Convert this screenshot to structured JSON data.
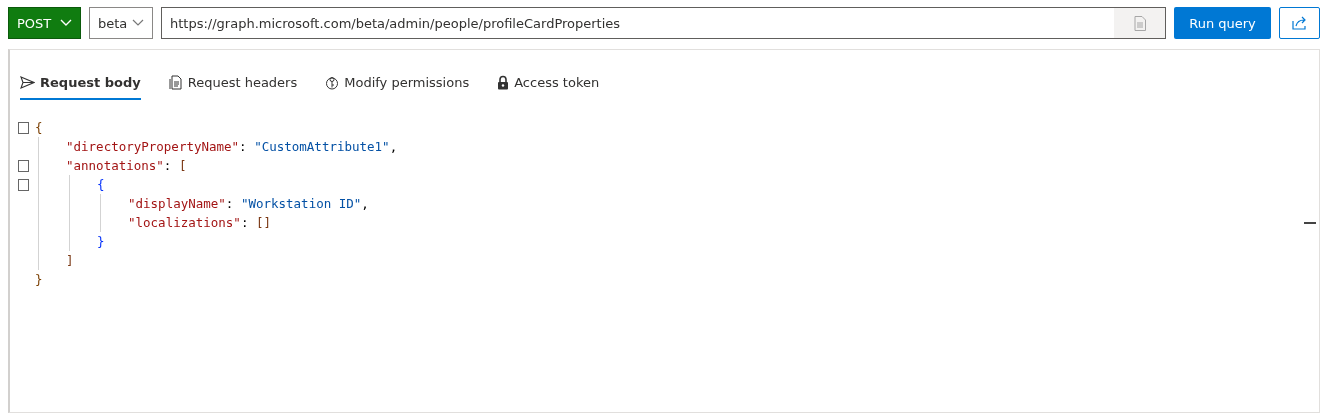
{
  "toolbar": {
    "method": "POST",
    "version": "beta",
    "url": "https://graph.microsoft.com/beta/admin/people/profileCardProperties",
    "run_button": "Run query"
  },
  "tabs": [
    {
      "label": "Request body",
      "selected": true
    },
    {
      "label": "Request headers",
      "selected": false
    },
    {
      "label": "Modify permissions",
      "selected": false
    },
    {
      "label": "Access token",
      "selected": false
    }
  ],
  "editor": {
    "code": {
      "tokens": [
        {
          "kind": "brace",
          "text": "{"
        }
      ],
      "children": [
        {
          "tokens": [
            {
              "kind": "key",
              "text": "\"directoryPropertyName\""
            },
            {
              "kind": "punct",
              "text": ": "
            },
            {
              "kind": "string",
              "text": "\"CustomAttribute1\""
            },
            {
              "kind": "punct",
              "text": ","
            }
          ]
        },
        {
          "tokens": [
            {
              "kind": "key",
              "text": "\"annotations\""
            },
            {
              "kind": "punct",
              "text": ": "
            },
            {
              "kind": "bracket",
              "text": "["
            }
          ],
          "children": [
            {
              "tokens": [
                {
                  "kind": "brace2",
                  "text": "{"
                }
              ],
              "children": [
                {
                  "tokens": [
                    {
                      "kind": "key",
                      "text": "\"displayName\""
                    },
                    {
                      "kind": "punct",
                      "text": ": "
                    },
                    {
                      "kind": "string",
                      "text": "\"Workstation ID\""
                    },
                    {
                      "kind": "punct",
                      "text": ","
                    }
                  ]
                },
                {
                  "tokens": [
                    {
                      "kind": "key",
                      "text": "\"localizations\""
                    },
                    {
                      "kind": "punct",
                      "text": ": "
                    },
                    {
                      "kind": "bracket",
                      "text": "[]"
                    }
                  ]
                }
              ],
              "closing": [
                {
                  "kind": "brace2",
                  "text": "}"
                }
              ]
            }
          ],
          "closing": [
            {
              "kind": "bracket",
              "text": "]"
            }
          ]
        }
      ],
      "closing": [
        {
          "kind": "brace",
          "text": "}"
        }
      ]
    }
  }
}
